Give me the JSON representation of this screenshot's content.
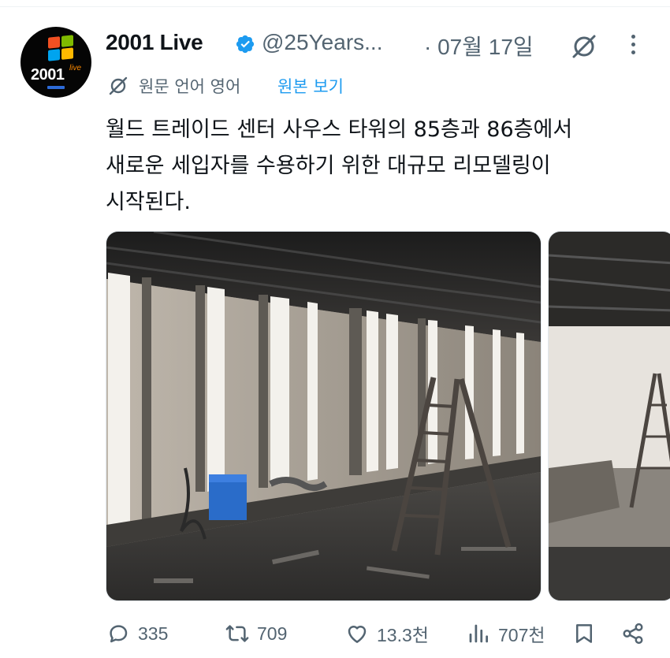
{
  "account": {
    "avatar_text": "2001",
    "avatar_badge": "live",
    "name": "2001 Live",
    "handle": "@25Years...",
    "time": "· 07월 17일"
  },
  "translation": {
    "label": "원문 언어 영어",
    "link": "원본 보기"
  },
  "tweet_text": "월드 트레이드 센터 사우스 타워의 85층과 86층에서\n새로운 세입자를 수용하기 위한 대규모 리모델링이\n시작된다.",
  "actions": {
    "replies": "335",
    "reposts": "709",
    "likes": "13.3천",
    "views": "707천"
  },
  "icons": [
    "verified-icon",
    "grok-icon",
    "more-icon",
    "translate-icon",
    "reply-icon",
    "repost-icon",
    "like-icon",
    "views-icon",
    "bookmark-icon",
    "share-icon"
  ],
  "colors": {
    "accent": "#1d9bf0",
    "secondary_text": "#536471",
    "primary_text": "#0f1419"
  }
}
